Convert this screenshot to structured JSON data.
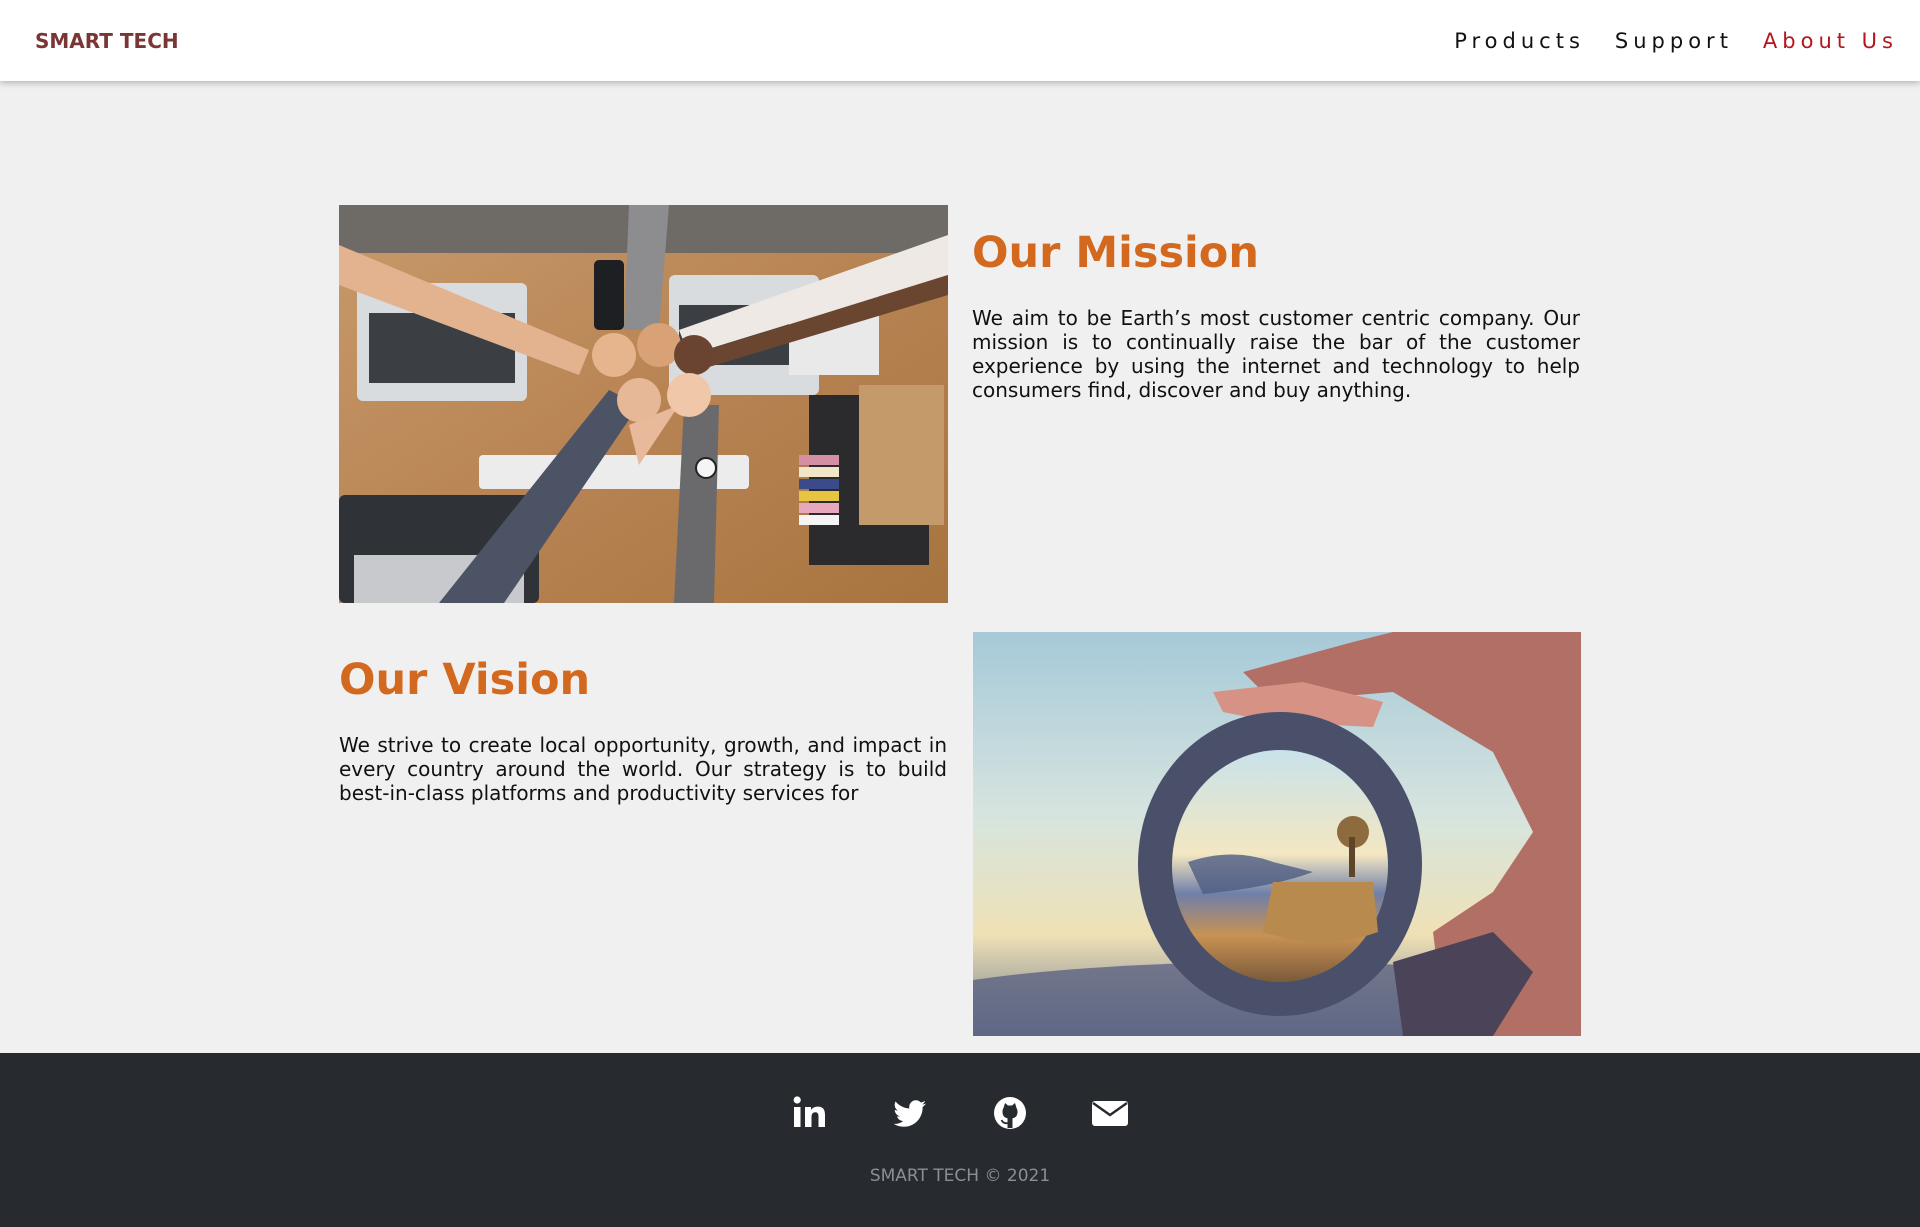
{
  "header": {
    "brand": "SMART TECH",
    "nav": [
      {
        "label": "Products"
      },
      {
        "label": "Support"
      },
      {
        "label": "About Us"
      }
    ],
    "active_nav": "About Us",
    "active_color": "#b3161b"
  },
  "mission": {
    "title": "Our Mission",
    "text": "We aim to be Earth’s most customer centric company. Our mission is to continually raise the bar of the customer experience by using the internet and technology to help consumers find, discover and buy anything."
  },
  "vision": {
    "title": "Our Vision",
    "text": "We strive to create local opportunity, growth, and impact in every country around the world. Our strategy is to build best-in-class platforms and productivity services for"
  },
  "footer": {
    "social_icons": [
      "linkedin-icon",
      "twitter-icon",
      "github-icon",
      "email-icon"
    ],
    "copyright": "SMART TECH © 2021"
  },
  "colors": {
    "heading": "#d2691e",
    "brand": "#7a3535",
    "footer_bg": "#272b30",
    "page_bg": "#f0f0f0"
  }
}
